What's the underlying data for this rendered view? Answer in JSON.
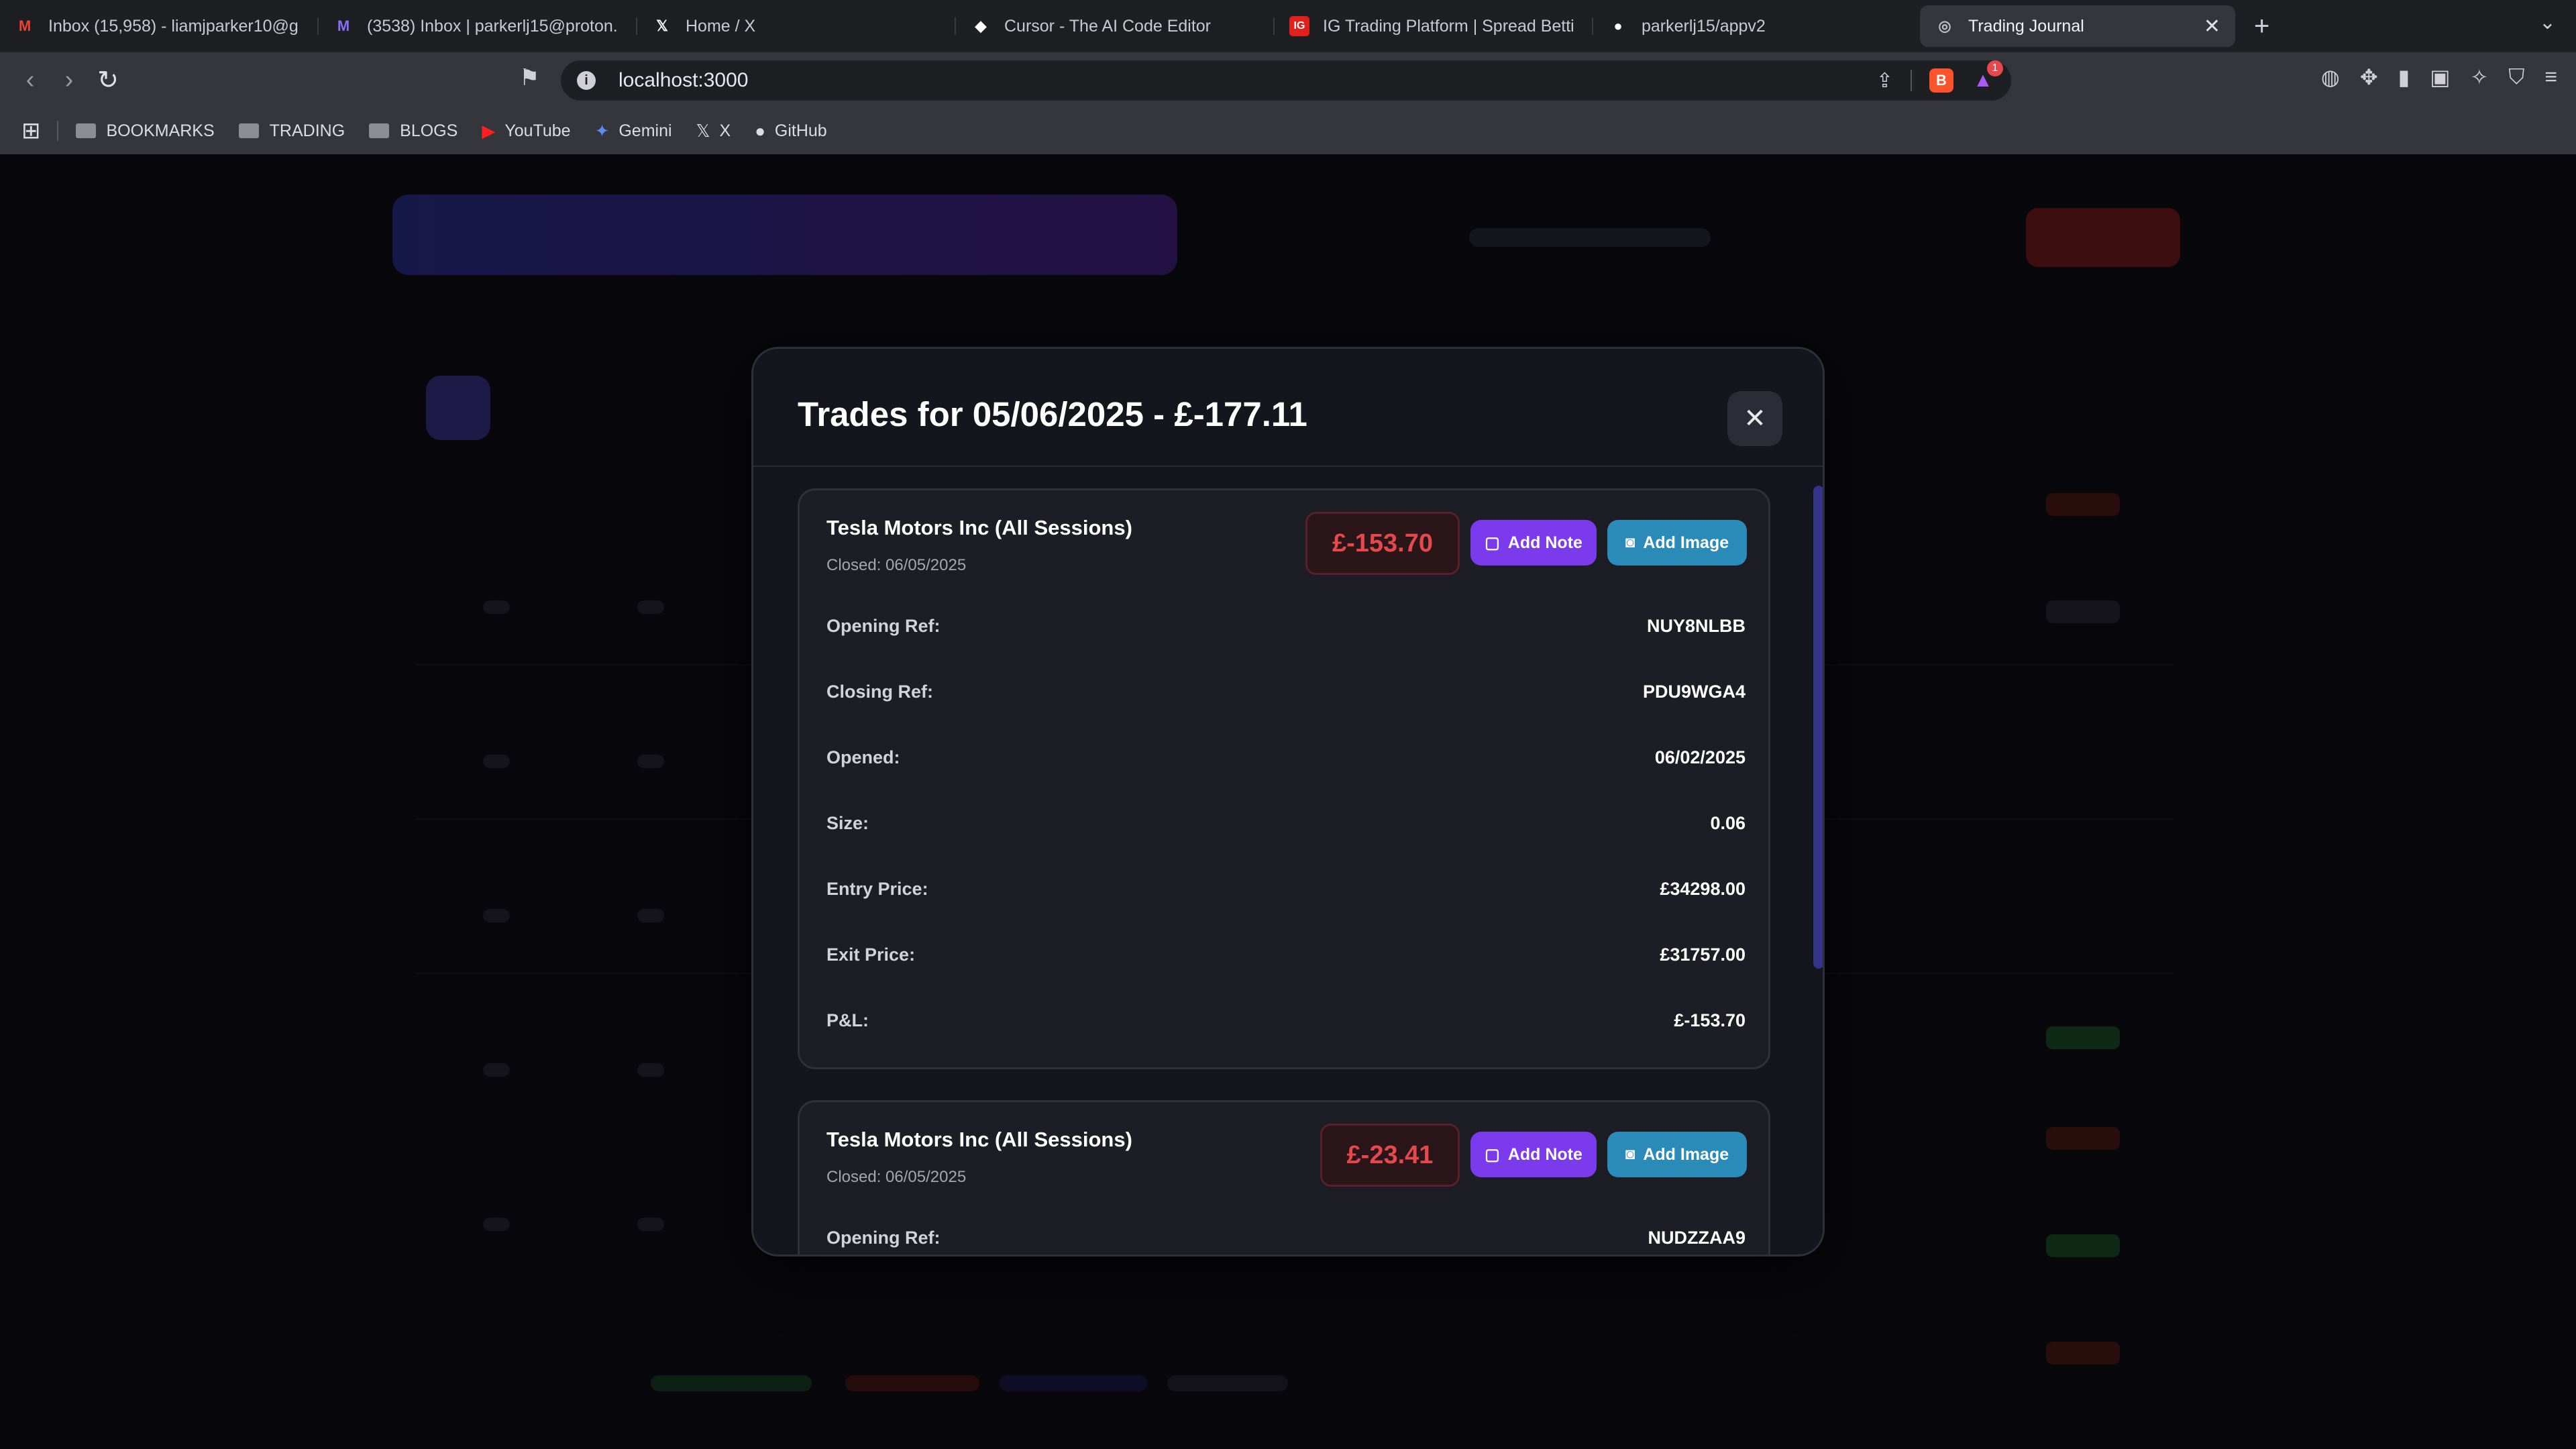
{
  "browser": {
    "tabs": [
      {
        "title": "Inbox (15,958) - liamjparker10@g",
        "icon": "gmail-icon",
        "icon_glyph": "M",
        "icon_color": "#ea4335"
      },
      {
        "title": "(3538) Inbox | parkerlj15@proton.",
        "icon": "proton-mail-icon",
        "icon_glyph": "M",
        "icon_color": "#8a6cf7"
      },
      {
        "title": "Home / X",
        "icon": "x-icon",
        "icon_glyph": "𝕏",
        "icon_color": "#ffffff"
      },
      {
        "title": "Cursor - The AI Code Editor",
        "icon": "cursor-icon",
        "icon_glyph": "◆",
        "icon_color": "#ffffff"
      },
      {
        "title": "IG Trading Platform | Spread Betti",
        "icon": "ig-icon",
        "icon_glyph": "IG",
        "icon_color": "#e0201b"
      },
      {
        "title": "parkerlj15/appv2",
        "icon": "github-icon",
        "icon_glyph": "●",
        "icon_color": "#ffffff"
      }
    ],
    "active_tab": {
      "title": "Trading Journal",
      "icon": "globe-icon",
      "close": "✕"
    },
    "new_tab": "+",
    "tab_menu": "⌄",
    "url": "localhost:3000",
    "rewards_badge": "1",
    "bookmarks": [
      {
        "label": "BOOKMARKS",
        "icon": "folder-icon"
      },
      {
        "label": "TRADING",
        "icon": "folder-icon"
      },
      {
        "label": "BLOGS",
        "icon": "folder-icon"
      },
      {
        "label": "YouTube",
        "icon": "youtube-icon"
      },
      {
        "label": "Gemini",
        "icon": "gemini-icon"
      },
      {
        "label": "X",
        "icon": "x-icon"
      },
      {
        "label": "GitHub",
        "icon": "github-icon"
      }
    ]
  },
  "modal": {
    "title": "Trades for 05/06/2025 - £-177.11",
    "close_icon": "✕",
    "trades": [
      {
        "name": "Tesla Motors Inc (All Sessions)",
        "closed": "Closed: 06/05/2025",
        "pnl": "£-153.70",
        "add_note": "Add Note",
        "add_image": "Add Image",
        "rows": [
          {
            "label": "Opening Ref:",
            "value": "NUY8NLBB"
          },
          {
            "label": "Closing Ref:",
            "value": "PDU9WGA4"
          },
          {
            "label": "Opened:",
            "value": "06/02/2025"
          },
          {
            "label": "Size:",
            "value": "0.06"
          },
          {
            "label": "Entry Price:",
            "value": "£34298.00"
          },
          {
            "label": "Exit Price:",
            "value": "£31757.00"
          },
          {
            "label": "P&L:",
            "value": "£-153.70"
          }
        ]
      },
      {
        "name": "Tesla Motors Inc (All Sessions)",
        "closed": "Closed: 06/05/2025",
        "pnl": "£-23.41",
        "add_note": "Add Note",
        "add_image": "Add Image",
        "rows": [
          {
            "label": "Opening Ref:",
            "value": "NUDZZAA9"
          }
        ]
      }
    ]
  },
  "colors": {
    "loss": "#e5484d",
    "note_button": "#7c3aed",
    "image_button": "#2b8bb8",
    "modal_bg": "#15151d",
    "card_bg": "#1d1d26"
  }
}
